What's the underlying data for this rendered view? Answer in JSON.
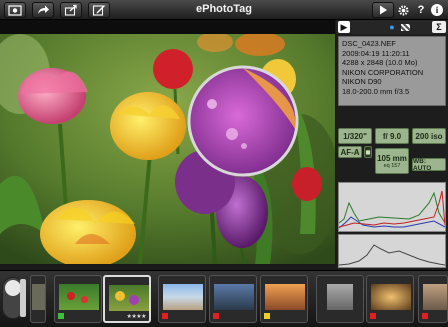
{
  "toolbar": {
    "title": "ePhotoTag",
    "left_buttons": [
      "photos-icon",
      "share-icon",
      "export-icon",
      "edit-icon"
    ],
    "right_buttons": [
      "play-icon",
      "gear-icon",
      "question-icon",
      "info-icon"
    ]
  },
  "panel": {
    "tabs": [
      "▶",
      "●",
      "Σ"
    ],
    "exif": {
      "filename": "DSC_0423.NEF",
      "datetime": "2009:04:19 11:20:11",
      "dimensions": "4288 x 2848 (10.0 Mo)",
      "make": "NIKON CORPORATION",
      "model": "NIKON D90",
      "lens": "18.0-200.0 mm f/3.5"
    },
    "settings": {
      "shutter": "1/320\"",
      "aperture": "f/ 9.0",
      "iso": "200 iso",
      "af_mode": "AF-A",
      "focal": "105 mm",
      "focal_sub": "eq 157",
      "wb": "WB: AUTO"
    }
  },
  "filmstrip": {
    "thumbs": [
      {
        "name": "thumb-partial",
        "fname": "jpg"
      },
      {
        "name": "thumb-red-flowers",
        "fname": "jpg"
      },
      {
        "name": "thumb-tulips",
        "fname": "jpg",
        "stars": "★★★★"
      },
      {
        "name": "thumb-beach",
        "fname": "jpg"
      },
      {
        "name": "thumb-mountain",
        "fname": "jpg"
      },
      {
        "name": "thumb-sunset",
        "fname": "jpg"
      },
      {
        "name": "thumb-church",
        "fname": "jpg"
      },
      {
        "name": "thumb-window",
        "fname": "jpg"
      },
      {
        "name": "thumb-building",
        "fname": "jpg"
      }
    ]
  },
  "colors": {
    "settings_bg": "#9cb58e",
    "exif_bg": "#9a9a9a"
  }
}
